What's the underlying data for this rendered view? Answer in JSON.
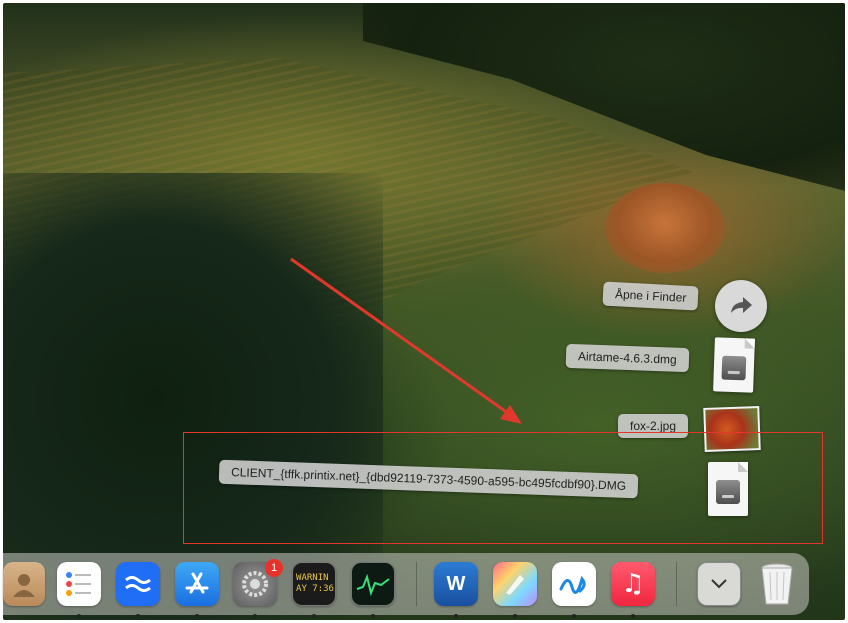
{
  "drag_items": {
    "open_in_finder": {
      "label": "Åpne i Finder",
      "icon": "arrow-right-circle-icon"
    },
    "airtame": {
      "label": "Airtame-4.6.3.dmg",
      "icon": "disk-image-file-icon"
    },
    "fox": {
      "label": "fox-2.jpg",
      "icon": "photo-thumbnail-icon"
    },
    "client": {
      "label": "CLIENT_{tffk.printix.net}_{dbd92119-7373-4590-a595-bc495fcdbf90}.DMG",
      "icon": "disk-image-file-icon"
    }
  },
  "annotation": {
    "color": "#e0392b"
  },
  "dock": {
    "apps": [
      {
        "name": "contacts",
        "icon": "contacts-icon"
      },
      {
        "name": "reminders",
        "icon": "reminders-icon"
      },
      {
        "name": "confluence",
        "icon": "waves-icon"
      },
      {
        "name": "app-store",
        "icon": "app-store-icon"
      },
      {
        "name": "system-settings",
        "icon": "gear-icon",
        "badge": "1"
      },
      {
        "name": "console",
        "icon": "console-icon",
        "text_line1": "WARNIN",
        "text_line2": "AY 7:36"
      },
      {
        "name": "activity-monitor",
        "icon": "activity-monitor-icon"
      },
      {
        "name": "word",
        "icon": "word-icon",
        "text": "W"
      },
      {
        "name": "graphic-app",
        "icon": "pen-icon"
      },
      {
        "name": "freeform",
        "icon": "freeform-icon"
      },
      {
        "name": "music",
        "icon": "music-note-icon",
        "text": "♫"
      },
      {
        "name": "downloads",
        "icon": "chevron-down-icon"
      },
      {
        "name": "trash",
        "icon": "trash-icon"
      }
    ]
  }
}
